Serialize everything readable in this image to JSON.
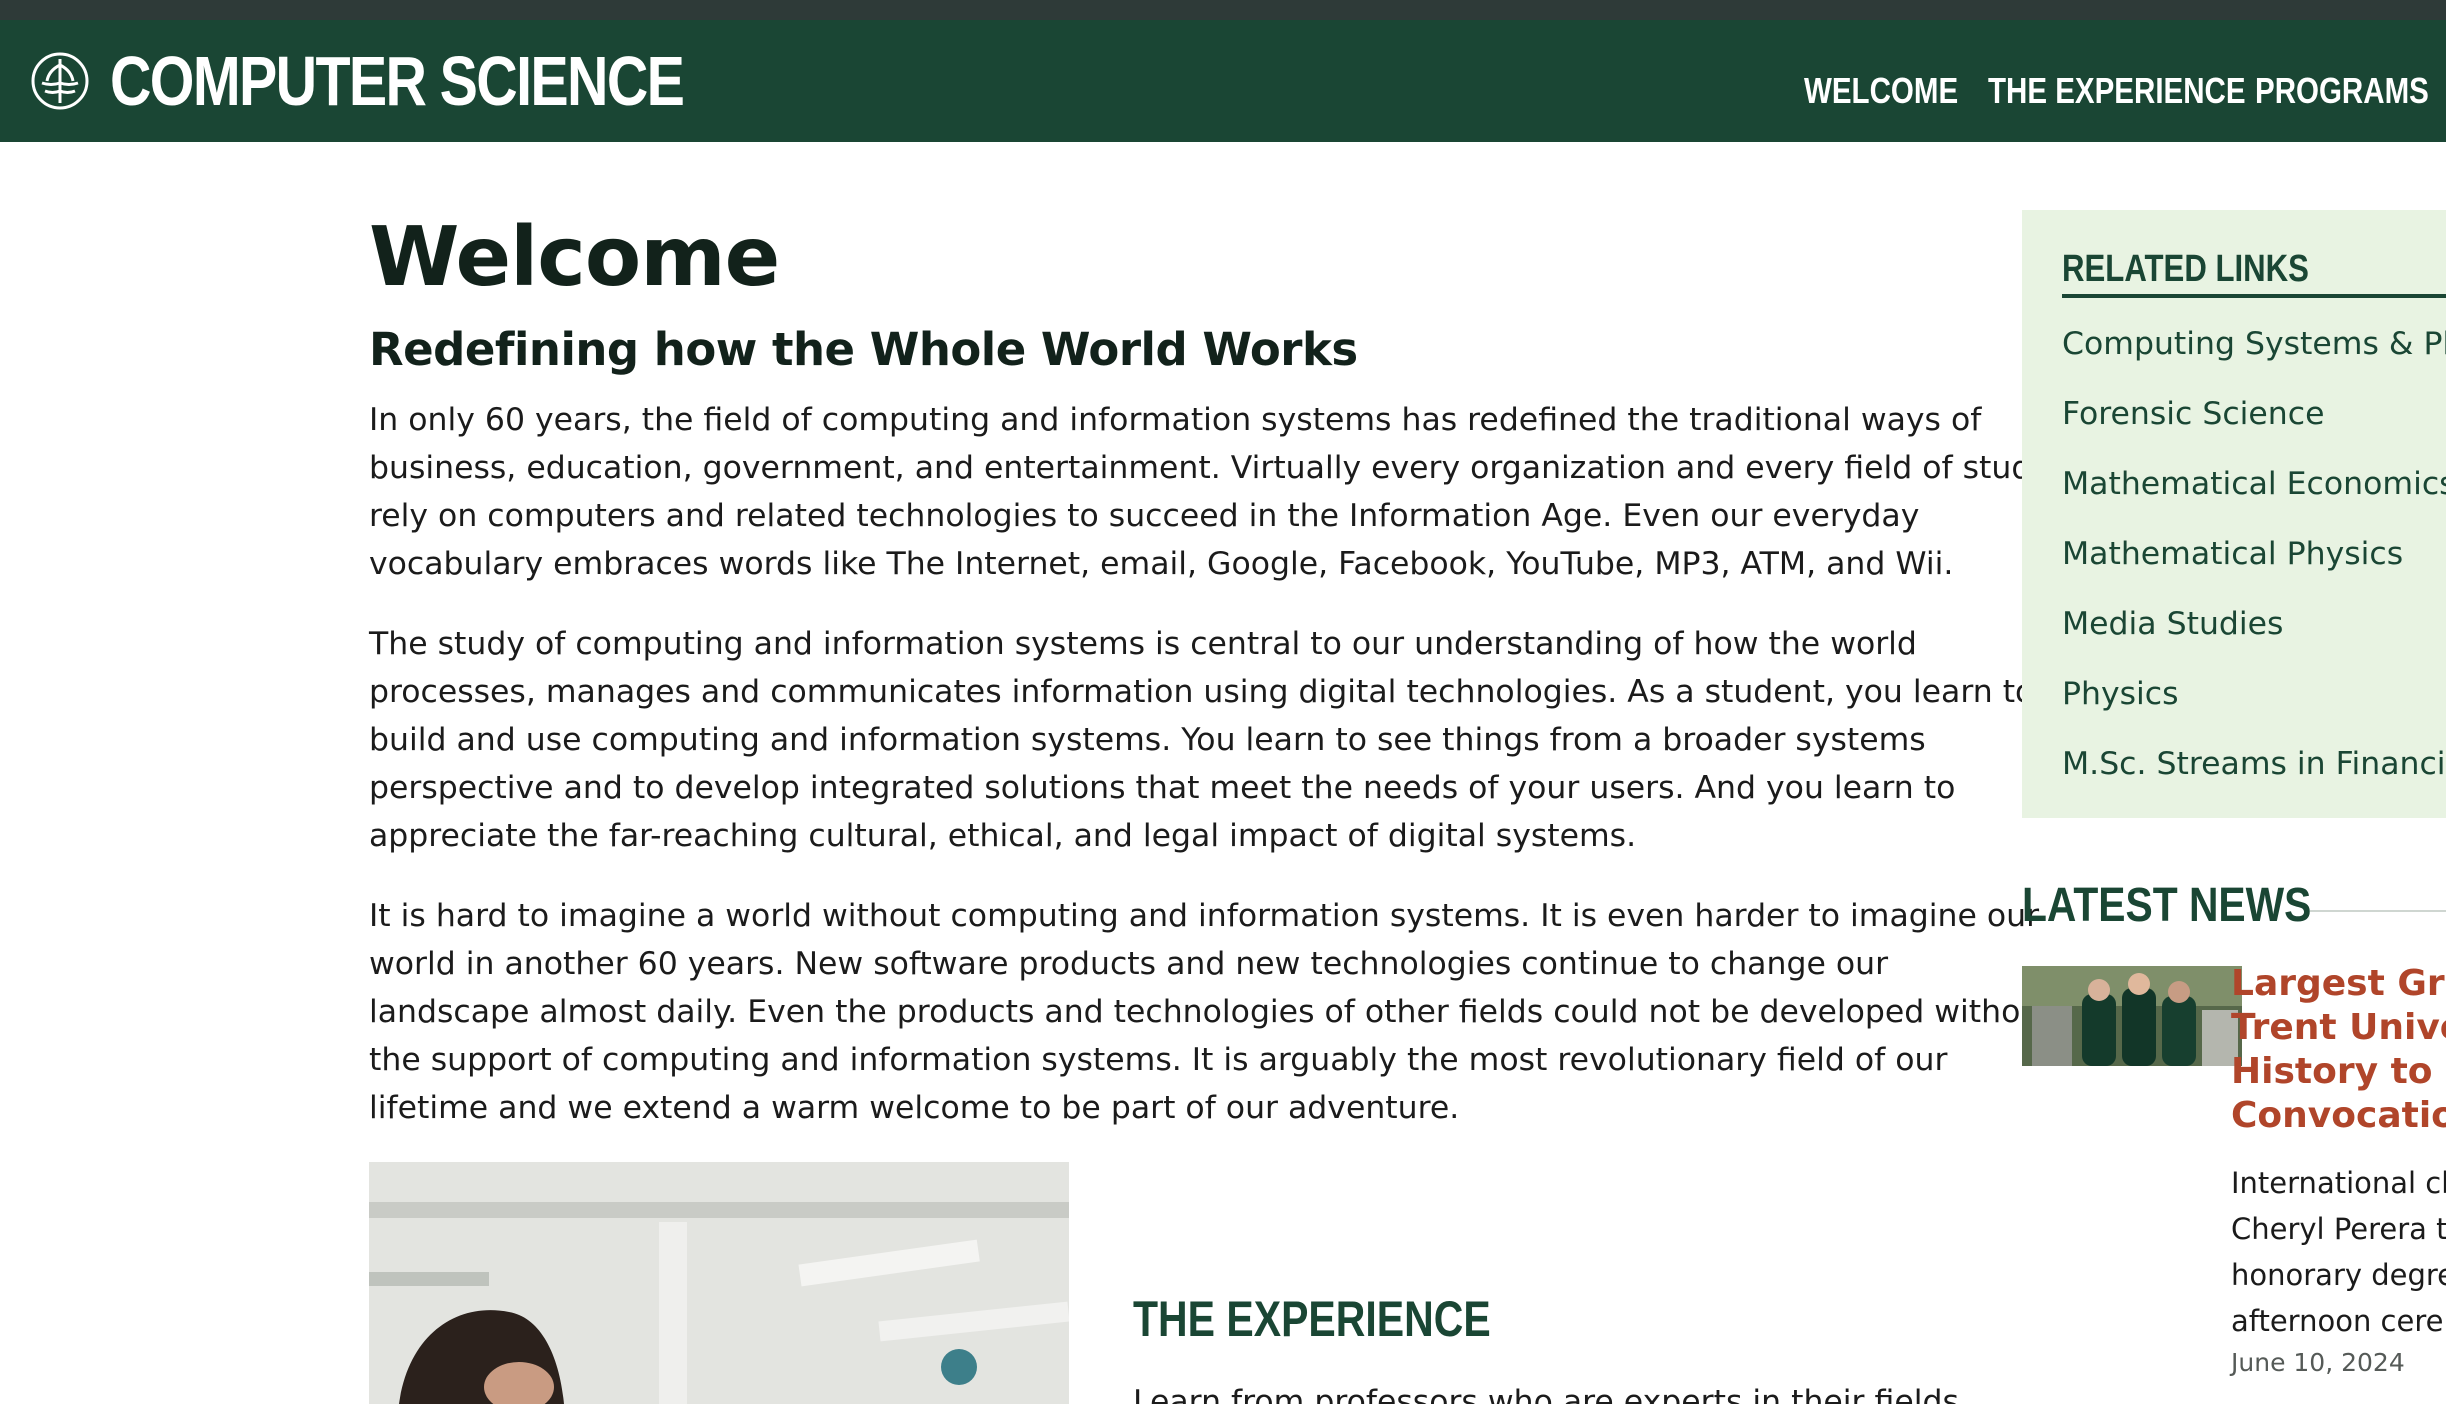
{
  "header": {
    "brand": "COMPUTER SCIENCE",
    "logo_icon": "trent-university-logo",
    "nav": [
      "WELCOME",
      "THE EXPERIENCE",
      "PROGRAMS"
    ],
    "bg_color": "#1a4634"
  },
  "main": {
    "title": "Welcome",
    "subtitle": "Redefining how the Whole World Works",
    "paragraphs": [
      [
        "In only 60 years, the field of computing and information systems has redefined the traditional ways of",
        "business, education, government, and entertainment.  Virtually every organization and every field of study",
        "rely on computers and related technologies to succeed in the Information Age.  Even our everyday",
        "vocabulary embraces words like The Internet, email, Google, Facebook, YouTube, MP3, ATM, and Wii."
      ],
      [
        "The study of computing and information systems is central to our understanding of how the world",
        "processes, manages and communicates information using digital technologies.  As a student, you learn to",
        "build and use computing and information systems.  You learn to see things from a broader systems",
        "perspective and to develop integrated solutions that meet the needs of your users.  And you learn to",
        "appreciate the far-reaching cultural, ethical, and legal impact of digital systems."
      ],
      [
        "It is hard to imagine a world without computing and information systems.  It is even harder to imagine our",
        "world in another 60 years.  New software products and new technologies continue to change our",
        "landscape almost daily.  Even the products and technologies of other fields could not be developed without",
        "the support of computing and information systems.  It is arguably the most revolutionary field of our",
        "lifetime and we extend a warm welcome to be part of our adventure."
      ]
    ],
    "experience": {
      "title": "THE EXPERIENCE",
      "text": "Learn from professors who are experts in their fields"
    }
  },
  "related": {
    "title": "RELATED LINKS",
    "links": [
      "Computing Systems & Physics",
      "Forensic Science",
      "Mathematical Economics",
      "Mathematical Physics",
      "Media Studies",
      "Physics",
      "M.Sc. Streams in Financial"
    ]
  },
  "news": {
    "title": "LATEST NEWS",
    "headline": [
      "Largest Grad",
      "Trent Univers",
      "History to be",
      "Convocation"
    ],
    "body": [
      "International ch",
      "Cheryl Perera to",
      "honorary degre",
      "afternoon ceren"
    ],
    "date": "June 10, 2024",
    "headline_color": "#b0452a"
  }
}
